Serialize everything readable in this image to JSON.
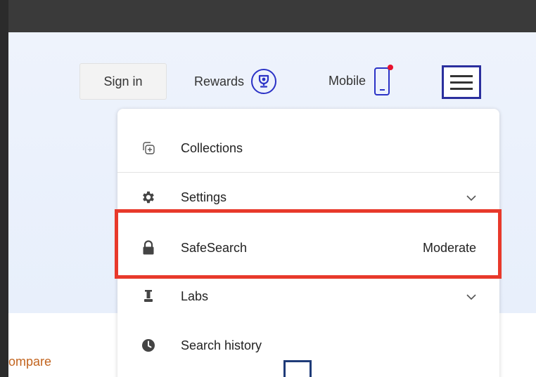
{
  "header": {
    "signin_label": "Sign in",
    "rewards_label": "Rewards",
    "mobile_label": "Mobile"
  },
  "menu": {
    "items": [
      {
        "label": "Collections",
        "icon": "collections-icon"
      },
      {
        "label": "Settings",
        "icon": "gear-icon",
        "right": "chevron-down-icon"
      },
      {
        "label": "SafeSearch",
        "icon": "lock-icon",
        "value": "Moderate"
      },
      {
        "label": "Labs",
        "icon": "flask-icon",
        "right": "chevron-down-icon"
      },
      {
        "label": "Search history",
        "icon": "clock-icon"
      }
    ]
  },
  "page": {
    "compare_text": "ompare"
  },
  "colors": {
    "accent": "#2b32c6",
    "highlight": "#e8392b",
    "notification": "#e8112d",
    "link": "#c2641e"
  }
}
